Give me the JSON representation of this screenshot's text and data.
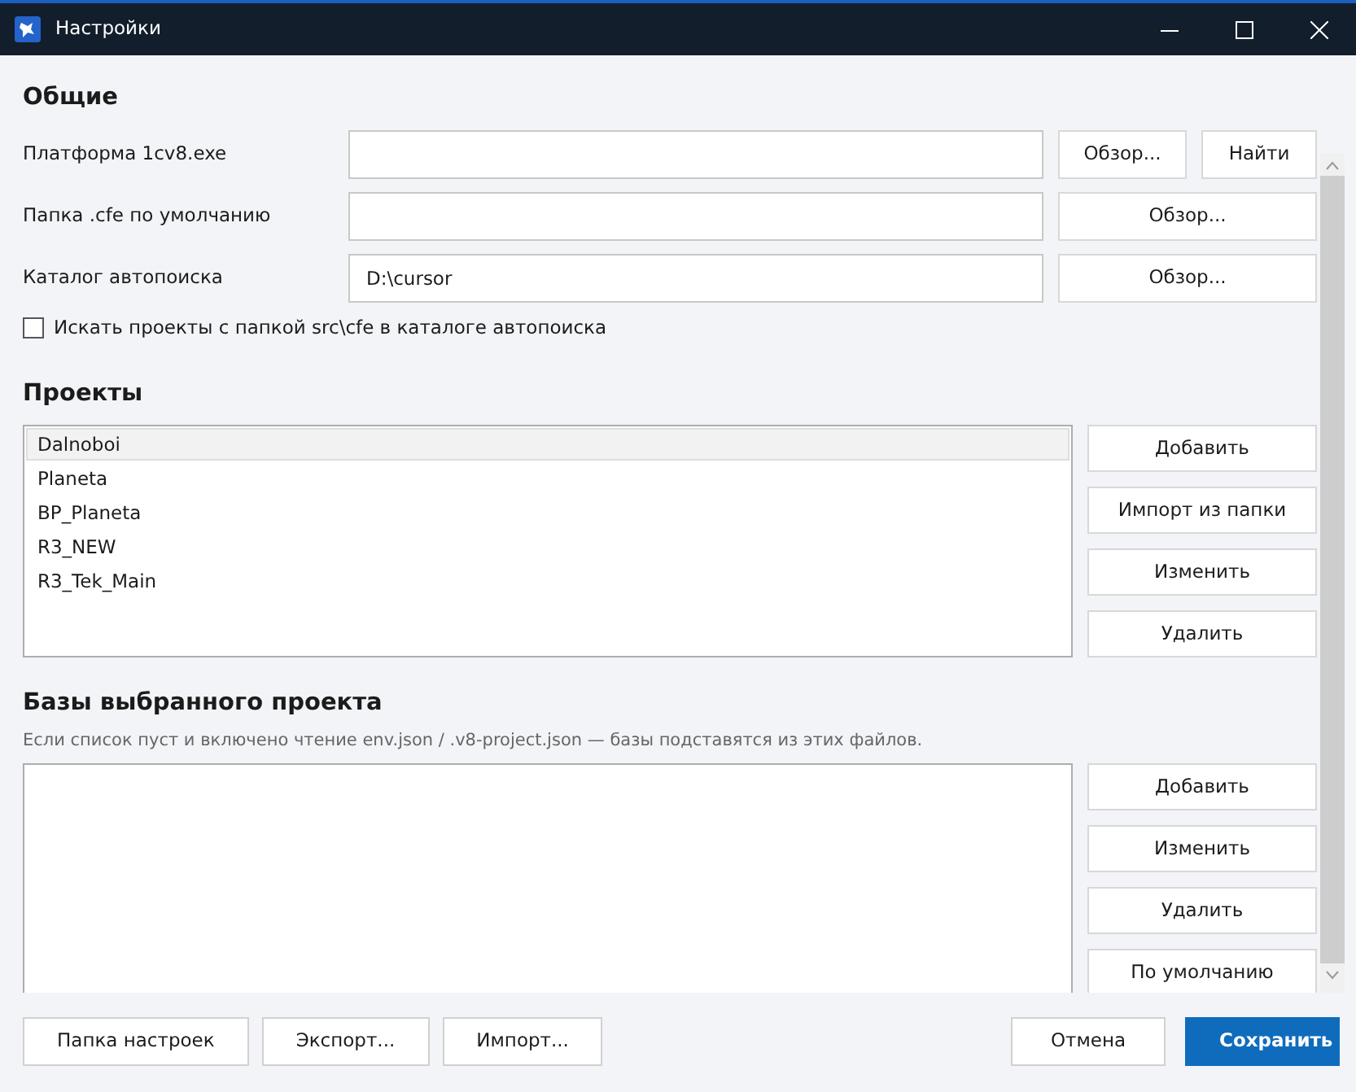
{
  "window": {
    "title": "Настройки"
  },
  "general": {
    "heading": "Общие",
    "fields": [
      {
        "label": "Платформа 1cv8.exe",
        "buttons": [
          "Обзор...",
          "Найти"
        ]
      },
      {
        "label": "Папка .cfe по умолчанию",
        "buttons": [
          "Обзор..."
        ]
      },
      {
        "label": "Каталог автопоиска",
        "value": "D:\\cursor",
        "buttons": [
          "Обзор..."
        ]
      }
    ],
    "checkbox": {
      "label": "Искать проекты с папкой src\\cfe в каталоге автопоиска",
      "checked": false
    }
  },
  "projects": {
    "heading": "Проекты",
    "items": [
      {
        "label": "Dalnoboi",
        "selected": true
      },
      {
        "label": "Planeta",
        "selected": false
      },
      {
        "label": "BP_Planeta",
        "selected": false
      },
      {
        "label": "R3_NEW",
        "selected": false
      },
      {
        "label": "R3_Tek_Main",
        "selected": false
      }
    ],
    "buttons": [
      "Добавить",
      "Импорт из папки",
      "Изменить",
      "Удалить"
    ]
  },
  "bases": {
    "heading": "Базы выбранного проекта",
    "hint": "Если список пуст и включено чтение env.json / .v8-project.json — базы подставятся из этих файлов.",
    "buttons": [
      "Добавить",
      "Изменить",
      "Удалить",
      "По умолчанию"
    ]
  },
  "footer": {
    "left": [
      {
        "label": "Папка настроек",
        "kind": "normal"
      },
      {
        "label": "Экспорт...",
        "kind": "normal"
      },
      {
        "label": "Импорт...",
        "kind": "normal"
      }
    ],
    "right": [
      {
        "label": "Отмена",
        "kind": "normal"
      },
      {
        "label": "Сохранить",
        "kind": "primary"
      }
    ]
  }
}
